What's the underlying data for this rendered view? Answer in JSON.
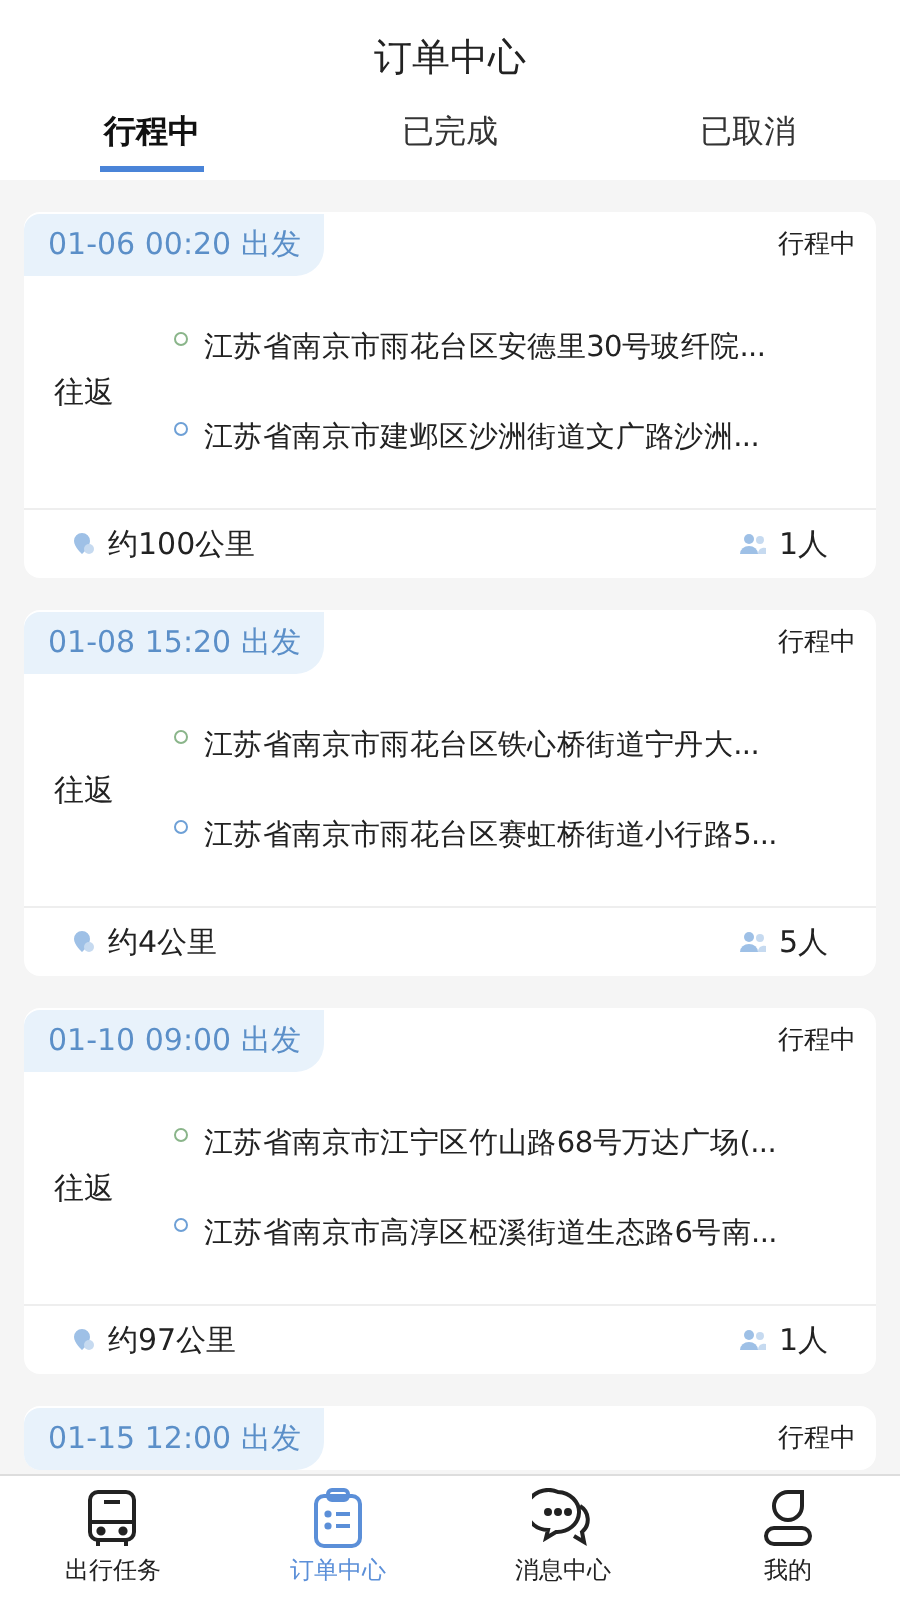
{
  "title": "订单中心",
  "tabs": [
    {
      "label": "行程中",
      "selected": true
    },
    {
      "label": "已完成",
      "selected": false
    },
    {
      "label": "已取消",
      "selected": false
    }
  ],
  "orders": [
    {
      "departure": "01-06 00:20 出发",
      "status": "行程中",
      "trip_type": "往返",
      "stops": [
        {
          "kind": "start",
          "address": "江苏省南京市雨花台区安德里30号玻纤院..."
        },
        {
          "kind": "end",
          "address": "江苏省南京市建邺区沙洲街道文广路沙洲..."
        }
      ],
      "distance": "约100公里",
      "passengers": "1人"
    },
    {
      "departure": "01-08 15:20 出发",
      "status": "行程中",
      "trip_type": "往返",
      "stops": [
        {
          "kind": "start",
          "address": "江苏省南京市雨花台区铁心桥街道宁丹大..."
        },
        {
          "kind": "end",
          "address": "江苏省南京市雨花台区赛虹桥街道小行路5..."
        }
      ],
      "distance": "约4公里",
      "passengers": "5人"
    },
    {
      "departure": "01-10 09:00 出发",
      "status": "行程中",
      "trip_type": "往返",
      "stops": [
        {
          "kind": "start",
          "address": "江苏省南京市江宁区竹山路68号万达广场(..."
        },
        {
          "kind": "end",
          "address": "江苏省南京市高淳区椏溪街道生态路6号南..."
        }
      ],
      "distance": "约97公里",
      "passengers": "1人"
    },
    {
      "departure": "01-15 12:00 出发",
      "status": "行程中"
    }
  ],
  "nav": [
    {
      "kind": "bus",
      "label": "出行任务",
      "selected": false
    },
    {
      "kind": "orders",
      "label": "订单中心",
      "selected": true
    },
    {
      "kind": "chat",
      "label": "消息中心",
      "selected": false
    },
    {
      "kind": "user",
      "label": "我的",
      "selected": false
    }
  ]
}
